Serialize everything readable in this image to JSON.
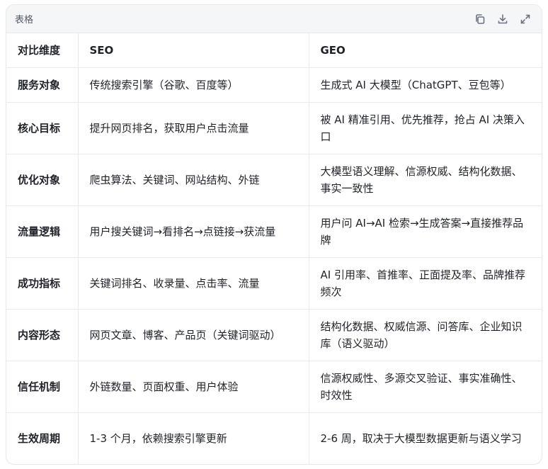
{
  "toolbar": {
    "title": "表格",
    "icons": [
      "copy-icon",
      "download-icon",
      "expand-icon"
    ]
  },
  "table": {
    "headers": [
      "对比维度",
      "SEO",
      "GEO"
    ],
    "rows": [
      [
        "服务对象",
        "传统搜索引擎（谷歌、百度等）",
        "生成式 AI 大模型（ChatGPT、豆包等）"
      ],
      [
        "核心目标",
        "提升网页排名，获取用户点击流量",
        "被 AI 精准引用、优先推荐，抢占 AI 决策入口"
      ],
      [
        "优化对象",
        "爬虫算法、关键词、网站结构、外链",
        "大模型语义理解、信源权威、结构化数据、事实一致性"
      ],
      [
        "流量逻辑",
        "用户搜关键词→看排名→点链接→获流量",
        "用户问 AI→AI 检索→生成答案→直接推荐品牌"
      ],
      [
        "成功指标",
        "关键词排名、收录量、点击率、流量",
        "AI 引用率、首推率、正面提及率、品牌推荐频次"
      ],
      [
        "内容形态",
        "网页文章、博客、产品页（关键词驱动）",
        "结构化数据、权威信源、问答库、企业知识库（语义驱动）"
      ],
      [
        "信任机制",
        "外链数量、页面权重、用户体验",
        "信源权威性、多源交叉验证、事实准确性、时效性"
      ],
      [
        "生效周期",
        "1-3 个月，依赖搜索引擎更新",
        "2-6 周，取决于大模型数据更新与语义学习"
      ]
    ]
  }
}
